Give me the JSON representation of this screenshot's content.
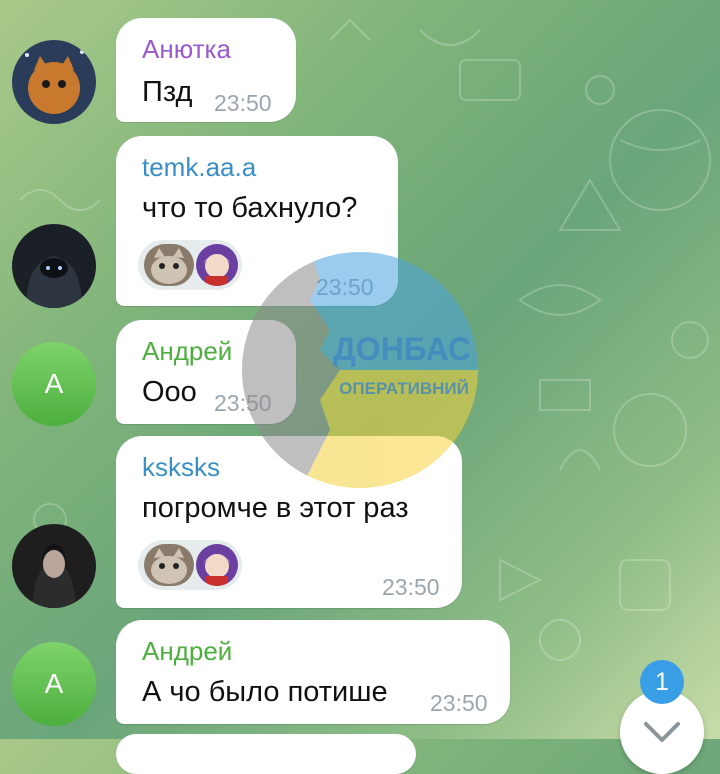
{
  "colors": {
    "name_purple": "#9b59d0",
    "name_blue": "#3a8fc7",
    "name_green": "#4caf3e",
    "bubble": "#ffffff",
    "time": "#9aa6ad",
    "badge": "#3a9ee6",
    "watermark_blue": "#4aa3df",
    "watermark_yellow": "#f5d23c"
  },
  "messages": [
    {
      "author": "Анютка",
      "text": "Пзд",
      "time": "23:50",
      "avatar": "cat-photo"
    },
    {
      "author": "temk.aa.a",
      "text": "что то бахнуло?",
      "time": "23:50",
      "avatar": "hooded-figure-photo",
      "reactions": [
        "cat-sticker-icon",
        "anime-avatar-icon"
      ]
    },
    {
      "author": "Андрей",
      "text": "Ооо",
      "time": "23:50",
      "avatar_letter": "А"
    },
    {
      "author": "ksksks",
      "text": "погромче в этот раз",
      "time": "23:50",
      "avatar": "dark-portrait-photo",
      "reactions": [
        "cat-sticker-icon",
        "anime-avatar-icon"
      ]
    },
    {
      "author": "Андрей",
      "text": "А чо было потише",
      "time": "23:50",
      "avatar_letter": "А"
    }
  ],
  "watermark": {
    "line1": "ДОНБАС",
    "line2": "ОПЕРАТИВНИЙ"
  },
  "scroll": {
    "unread_count": "1",
    "icon": "chevron-down-icon"
  }
}
